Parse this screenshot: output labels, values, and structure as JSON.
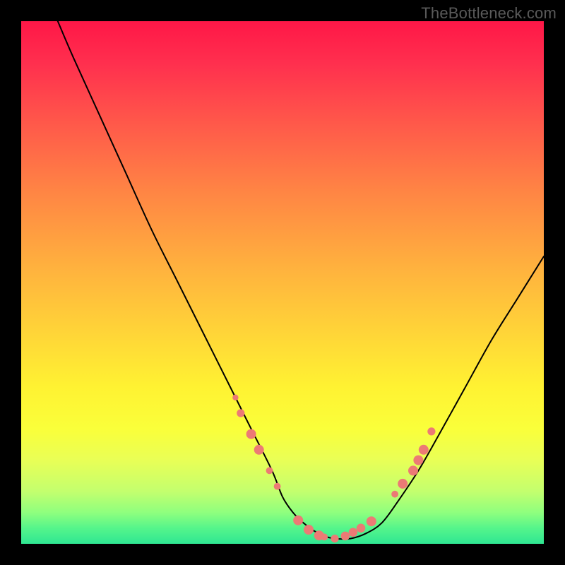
{
  "watermark": "TheBottleneck.com",
  "chart_data": {
    "type": "line",
    "title": "",
    "xlabel": "",
    "ylabel": "",
    "xlim": [
      0,
      100
    ],
    "ylim": [
      0,
      100
    ],
    "grid": false,
    "series": [
      {
        "name": "curve",
        "color": "#000000",
        "x": [
          7,
          10,
          15,
          20,
          25,
          30,
          35,
          40,
          44,
          48,
          50,
          52,
          54,
          56,
          58,
          60,
          63,
          66,
          69,
          72,
          76,
          80,
          85,
          90,
          95,
          100
        ],
        "y": [
          100,
          93,
          82,
          71,
          60,
          50,
          40,
          30,
          22,
          14,
          9,
          6,
          4,
          2.5,
          1.5,
          1,
          1,
          2,
          4,
          8,
          14,
          21,
          30,
          39,
          47,
          55
        ]
      }
    ],
    "markers": [
      {
        "x": 41,
        "y": 28,
        "r": 3
      },
      {
        "x": 42,
        "y": 25,
        "r": 4
      },
      {
        "x": 44,
        "y": 21,
        "r": 5
      },
      {
        "x": 45.5,
        "y": 18,
        "r": 5
      },
      {
        "x": 47.5,
        "y": 14,
        "r": 3.5
      },
      {
        "x": 49,
        "y": 11,
        "r": 3.5
      },
      {
        "x": 53,
        "y": 4.5,
        "r": 5
      },
      {
        "x": 55,
        "y": 2.7,
        "r": 5
      },
      {
        "x": 57,
        "y": 1.6,
        "r": 5
      },
      {
        "x": 58,
        "y": 1.3,
        "r": 3.5
      },
      {
        "x": 60,
        "y": 1.0,
        "r": 4
      },
      {
        "x": 62,
        "y": 1.5,
        "r": 4.5
      },
      {
        "x": 63.5,
        "y": 2.2,
        "r": 4.5
      },
      {
        "x": 65,
        "y": 3.0,
        "r": 4.5
      },
      {
        "x": 67,
        "y": 4.3,
        "r": 5
      },
      {
        "x": 71.5,
        "y": 9.5,
        "r": 3.5
      },
      {
        "x": 73,
        "y": 11.5,
        "r": 5
      },
      {
        "x": 75,
        "y": 14,
        "r": 5
      },
      {
        "x": 76,
        "y": 16,
        "r": 5
      },
      {
        "x": 77,
        "y": 18,
        "r": 5
      },
      {
        "x": 78.5,
        "y": 21.5,
        "r": 4
      }
    ],
    "marker_color": "#ec7a75",
    "gradient_stops": [
      {
        "pos": 0,
        "color": "#ff1747"
      },
      {
        "pos": 8,
        "color": "#ff2f4e"
      },
      {
        "pos": 20,
        "color": "#ff5a4a"
      },
      {
        "pos": 33,
        "color": "#ff8644"
      },
      {
        "pos": 47,
        "color": "#ffb13e"
      },
      {
        "pos": 59,
        "color": "#ffd338"
      },
      {
        "pos": 70,
        "color": "#fff232"
      },
      {
        "pos": 78,
        "color": "#faff3a"
      },
      {
        "pos": 84,
        "color": "#e9ff56"
      },
      {
        "pos": 90,
        "color": "#c3ff6e"
      },
      {
        "pos": 94,
        "color": "#8fff7e"
      },
      {
        "pos": 97,
        "color": "#55f58b"
      },
      {
        "pos": 100,
        "color": "#2fe692"
      }
    ]
  }
}
